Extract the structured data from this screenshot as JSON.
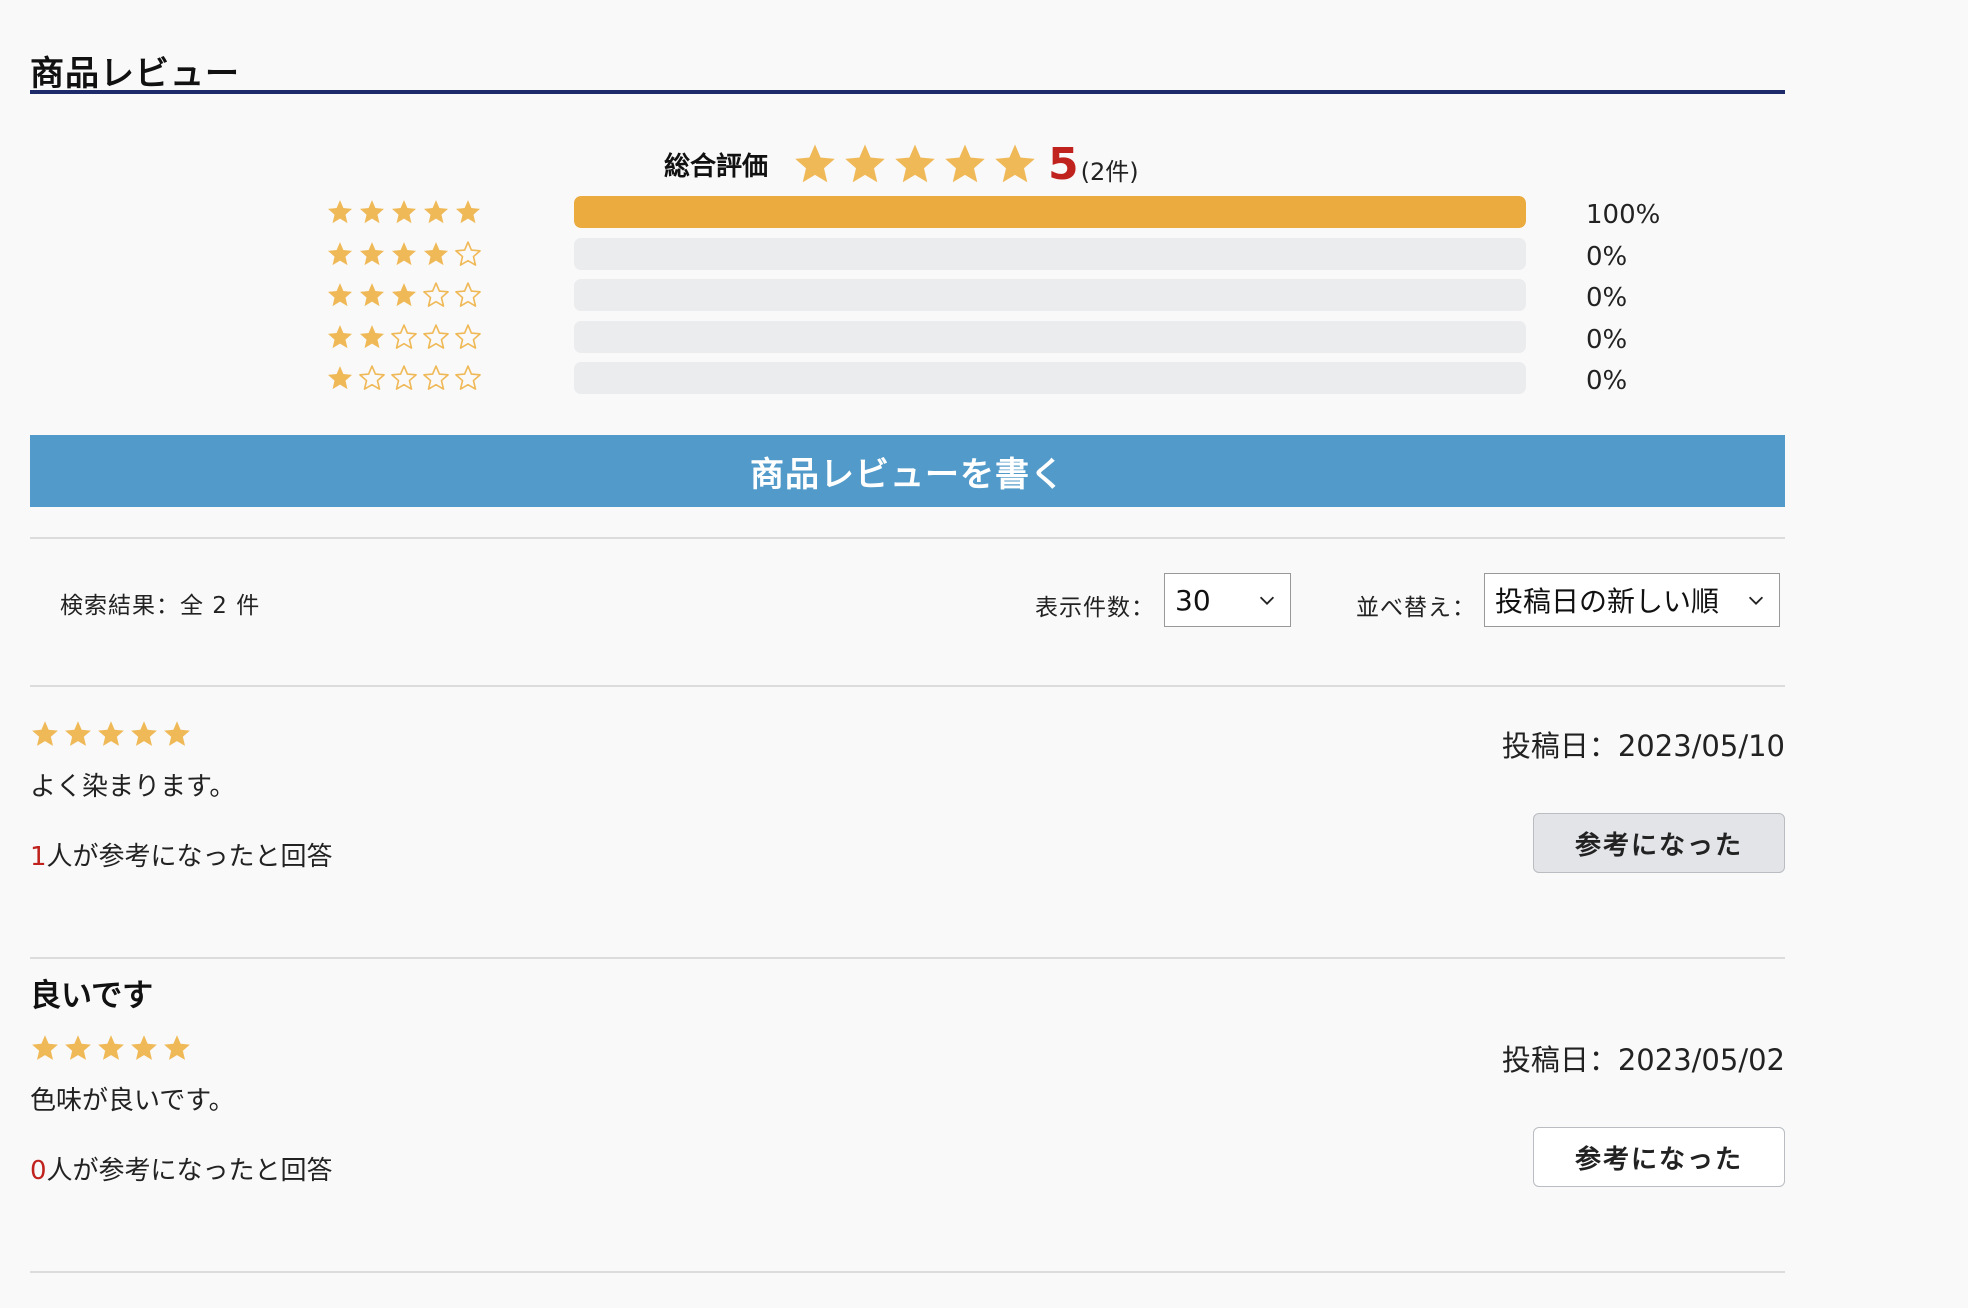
{
  "header": {
    "title": "商品レビュー"
  },
  "summary": {
    "label": "総合評価",
    "stars": 5,
    "score": "5",
    "count_text": "(2件)"
  },
  "distribution": [
    {
      "stars": 5,
      "fraction": 1.0,
      "percent_text": "100%"
    },
    {
      "stars": 4,
      "fraction": 0.0,
      "percent_text": "0%"
    },
    {
      "stars": 3,
      "fraction": 0.0,
      "percent_text": "0%"
    },
    {
      "stars": 2,
      "fraction": 0.0,
      "percent_text": "0%"
    },
    {
      "stars": 1,
      "fraction": 0.0,
      "percent_text": "0%"
    }
  ],
  "write_button": {
    "label": "商品レビューを書く"
  },
  "controls": {
    "results_text": "検索結果：全 2 件",
    "per_page_label": "表示件数：",
    "per_page_value": "30",
    "sort_label": "並べ替え：",
    "sort_value": "投稿日の新しい順"
  },
  "reviews": [
    {
      "title": "",
      "stars": 5,
      "body": "よく染まります。",
      "helpful_count": "1",
      "helpful_suffix": "人が参考になったと回答",
      "date": "投稿日：2023/05/10",
      "button_label": "参考になった"
    },
    {
      "title": "良いです",
      "stars": 5,
      "body": "色味が良いです。",
      "helpful_count": "0",
      "helpful_suffix": "人が参考になったと回答",
      "date": "投稿日：2023/05/02",
      "button_label": "参考になった"
    }
  ],
  "colors": {
    "star": "#f0b957",
    "bar_fill": "#ecab3e",
    "bar_track": "#ebecee",
    "accent_red": "#c0221d",
    "write_button": "#519ac9",
    "title_rule": "#1e2b6b"
  }
}
